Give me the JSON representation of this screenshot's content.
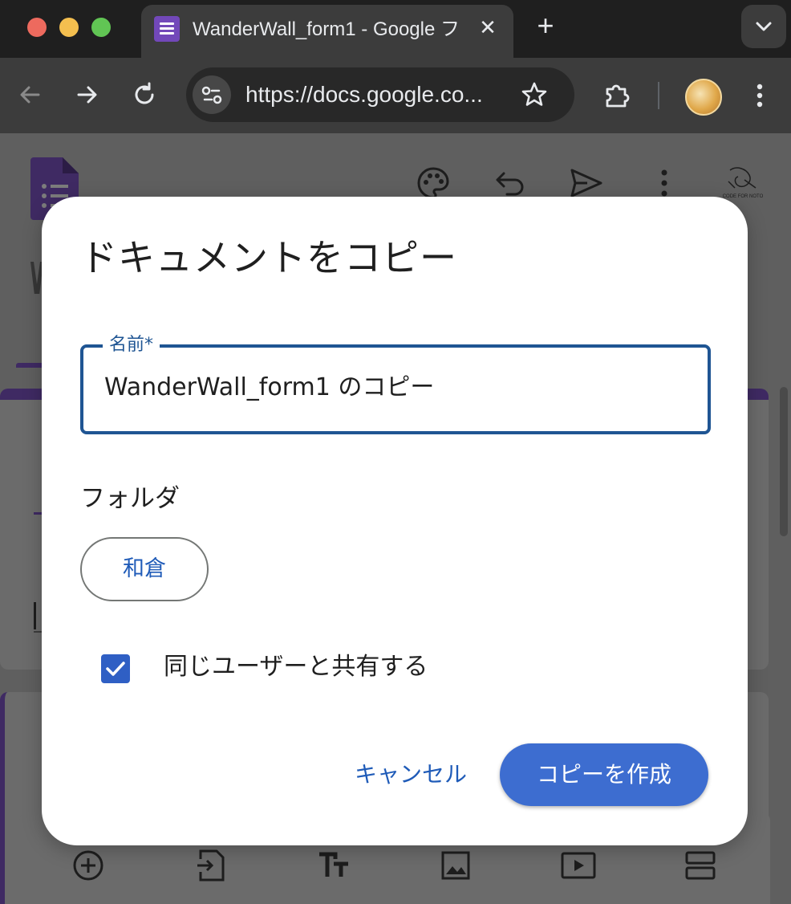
{
  "browser": {
    "tab": {
      "title": "WanderWall_form1 - Google フ",
      "close_glyph": "✕"
    },
    "new_tab_glyph": "+",
    "address_bar": {
      "url": "https://docs.google.co..."
    },
    "icons": {
      "back": "arrow-left-icon",
      "forward": "arrow-right-icon",
      "reload": "reload-icon",
      "site_settings": "tune-icon",
      "bookmark": "star-icon",
      "extensions": "puzzle-icon",
      "profile": "avatar",
      "menu": "kebab-menu-icon",
      "tab_search": "chevron-down-icon"
    }
  },
  "forms_toolbar": {
    "icons": [
      "palette-icon",
      "undo-icon",
      "send-icon",
      "more-vert-icon"
    ],
    "brand_logo_text": "CODE FOR NOTO"
  },
  "bottom_toolbar": {
    "icons": [
      "add-circle-icon",
      "import-icon",
      "title-text-icon",
      "image-icon",
      "video-icon",
      "section-icon"
    ]
  },
  "dialog": {
    "title": "ドキュメントをコピー",
    "name_field": {
      "label": "名前*",
      "value": "WanderWall_form1 のコピー"
    },
    "folder": {
      "label": "フォルダ",
      "value": "和倉"
    },
    "share_checkbox": {
      "label": "同じユーザーと共有する",
      "checked": true
    },
    "buttons": {
      "cancel": "キャンセル",
      "create": "コピーを作成"
    }
  },
  "colors": {
    "accent_blue": "#1f5bb8",
    "primary_button": "#3d6dd0",
    "field_border": "#1f5593",
    "forms_purple": "#7248b9"
  }
}
